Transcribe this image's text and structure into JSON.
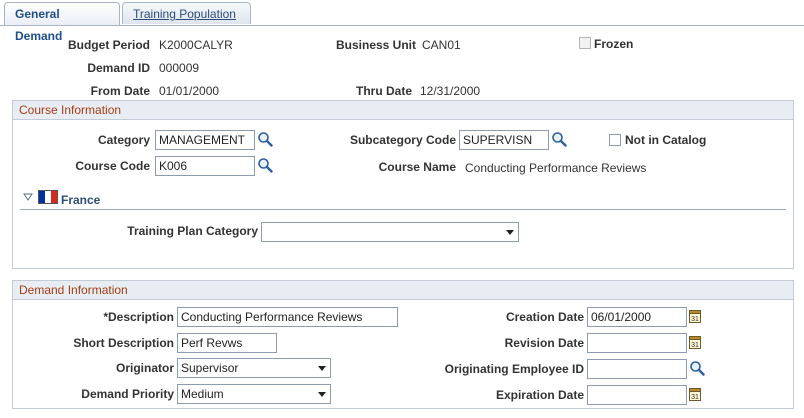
{
  "tabs": [
    {
      "label": "General Demand",
      "active": true
    },
    {
      "label": "Training Population",
      "active": false
    }
  ],
  "header": {
    "budget_period_label": "Budget Period",
    "budget_period_value": "K2000CALYR",
    "business_unit_label": "Business Unit",
    "business_unit_value": "CAN01",
    "frozen_label": "Frozen",
    "demand_id_label": "Demand ID",
    "demand_id_value": "000009",
    "from_date_label": "From Date",
    "from_date_value": "01/01/2000",
    "thru_date_label": "Thru Date",
    "thru_date_value": "12/31/2000"
  },
  "course_info": {
    "title": "Course Information",
    "category_label": "Category",
    "category_value": "MANAGEMENT",
    "subcategory_label": "Subcategory Code",
    "subcategory_value": "SUPERVISN",
    "not_in_catalog_label": "Not in Catalog",
    "course_code_label": "Course Code",
    "course_code_value": "K006",
    "course_name_label": "Course Name",
    "course_name_value": "Conducting Performance Reviews",
    "country_label": "France",
    "training_plan_category_label": "Training Plan Category",
    "training_plan_category_value": ""
  },
  "demand_info": {
    "title": "Demand Information",
    "description_label": "*Description",
    "description_value": "Conducting Performance Reviews",
    "short_description_label": "Short Description",
    "short_description_value": "Perf Revws",
    "originator_label": "Originator",
    "originator_value": "Supervisor",
    "demand_priority_label": "Demand Priority",
    "demand_priority_value": "Medium",
    "creation_date_label": "Creation Date",
    "creation_date_value": "06/01/2000",
    "revision_date_label": "Revision Date",
    "revision_date_value": "",
    "originating_employee_label": "Originating Employee ID",
    "originating_employee_value": "",
    "expiration_date_label": "Expiration Date",
    "expiration_date_value": ""
  },
  "colors": {
    "section_title": "#a33d14",
    "tab_text": "#1e4f8c",
    "flag_blue": "#0033a0",
    "flag_white": "#ffffff",
    "flag_red": "#d52b1e"
  },
  "icons": {
    "lookup": "magnifier-icon",
    "calendar": "calendar-icon",
    "expand": "triangle-down-icon",
    "flag": "france-flag-icon"
  }
}
